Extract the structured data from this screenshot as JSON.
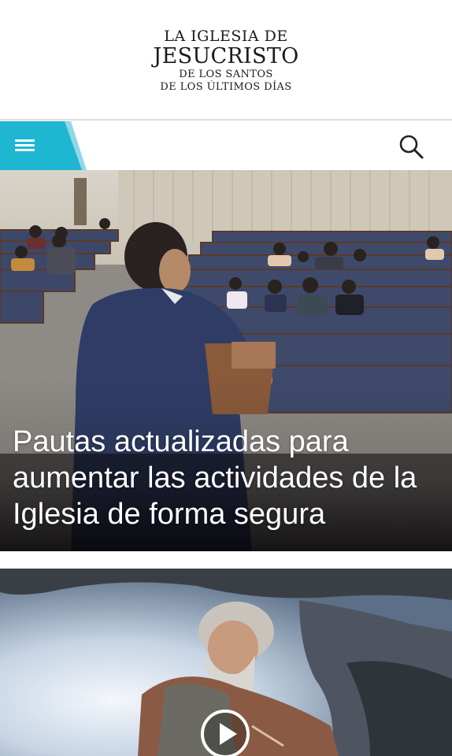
{
  "logo": {
    "line1": "LA IGLESIA DE",
    "line2": "JESUCRISTO",
    "line3": "DE LOS SANTOS",
    "line4": "DE LOS ÚLTIMOS DÍAS"
  },
  "nav": {
    "menu_icon": "hamburger-menu-icon",
    "search_icon": "search-icon",
    "accent_color": "#1eb6d1"
  },
  "hero": {
    "title": "Pautas actualizadas para aumentar las actividades de la Iglesia de forma segura"
  },
  "card2": {
    "play_icon": "play-icon"
  }
}
